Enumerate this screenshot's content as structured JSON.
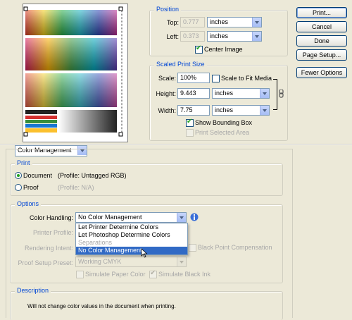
{
  "colors": {
    "dialog_bg": "#ece9d8",
    "group_title": "#0046d5",
    "selection": "#316ac5",
    "check": "#21a121"
  },
  "position": {
    "title": "Position",
    "top_label": "Top:",
    "top_value": "0.777",
    "top_unit": "inches",
    "left_label": "Left:",
    "left_value": "0.373",
    "left_unit": "inches",
    "center_image_label": "Center Image",
    "center_image_checked": true
  },
  "scaled": {
    "title": "Scaled Print Size",
    "scale_label": "Scale:",
    "scale_value": "100%",
    "scale_to_fit_label": "Scale to Fit Media",
    "height_label": "Height:",
    "height_value": "9.443",
    "height_unit": "inches",
    "width_label": "Width:",
    "width_value": "7.75",
    "width_unit": "inches",
    "show_bbox_label": "Show Bounding Box",
    "show_bbox_checked": true,
    "print_selected_label": "Print Selected Area"
  },
  "buttons": {
    "print": "Print...",
    "cancel": "Cancel",
    "done": "Done",
    "page_setup": "Page Setup...",
    "fewer_options": "Fewer Options"
  },
  "cm_dropdown": "Color Management",
  "print_group": {
    "title": "Print",
    "document_label": "Document",
    "document_profile": "(Profile: Untagged RGB)",
    "proof_label": "Proof",
    "proof_profile": "(Profile: N/A)"
  },
  "options": {
    "title": "Options",
    "color_handling_label": "Color Handling:",
    "color_handling_value": "No Color Management",
    "printer_profile_label": "Printer Profile:",
    "rendering_intent_label": "Rendering Intent:",
    "black_point_label": "Black Point Compensation",
    "proof_setup_label": "Proof Setup Preset:",
    "proof_setup_value": "Working CMYK",
    "simulate_paper_label": "Simulate Paper Color",
    "simulate_ink_label": "Simulate Black Ink",
    "menu_items": [
      "Let Printer Determine Colors",
      "Let Photoshop Determine Colors",
      "Separations",
      "No Color Management"
    ]
  },
  "description": {
    "title": "Description",
    "text": "Will not change color values in the document when printing."
  }
}
